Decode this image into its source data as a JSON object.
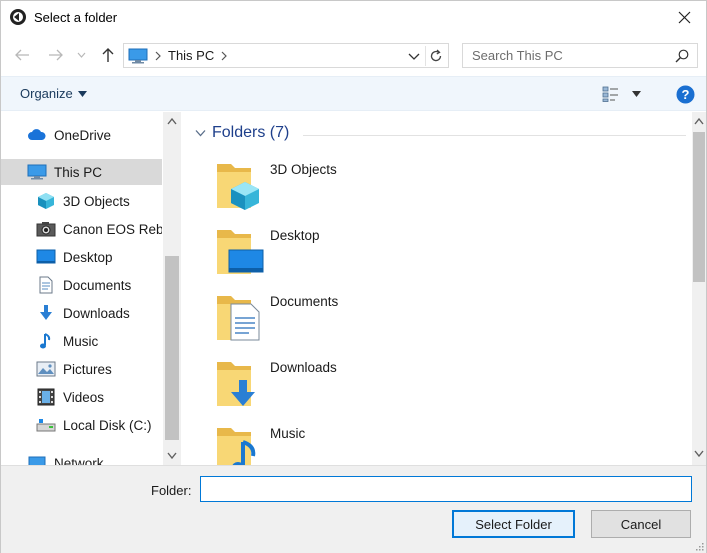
{
  "window": {
    "title": "Select a folder",
    "icon": "app-circle-icon"
  },
  "navigation": {
    "back_icon": "arrow-left-icon",
    "forward_icon": "arrow-right-icon",
    "recent_icon": "chevron-down-icon",
    "up_icon": "arrow-up-icon",
    "breadcrumb": [
      {
        "label": "This PC",
        "icon": "computer-icon"
      }
    ],
    "search_placeholder": "Search This PC"
  },
  "toolbar": {
    "organize_label": "Organize",
    "view_icon": "view-options-icon",
    "help_icon": "help-icon"
  },
  "nav_pane": {
    "items": [
      {
        "label": "OneDrive",
        "icon": "cloud-icon",
        "level": 0,
        "selected": false
      },
      {
        "label": "This PC",
        "icon": "computer-icon",
        "level": 0,
        "selected": true
      },
      {
        "label": "3D Objects",
        "icon": "cube-icon",
        "level": 1,
        "selected": false
      },
      {
        "label": "Canon EOS Rebel",
        "icon": "camera-icon",
        "level": 1,
        "selected": false
      },
      {
        "label": "Desktop",
        "icon": "desktop-icon",
        "level": 1,
        "selected": false
      },
      {
        "label": "Documents",
        "icon": "document-icon",
        "level": 1,
        "selected": false
      },
      {
        "label": "Downloads",
        "icon": "download-icon",
        "level": 1,
        "selected": false
      },
      {
        "label": "Music",
        "icon": "music-note-icon",
        "level": 1,
        "selected": false
      },
      {
        "label": "Pictures",
        "icon": "picture-icon",
        "level": 1,
        "selected": false
      },
      {
        "label": "Videos",
        "icon": "film-icon",
        "level": 1,
        "selected": false
      },
      {
        "label": "Local Disk (C:)",
        "icon": "drive-icon",
        "level": 1,
        "selected": false
      },
      {
        "label": "Network",
        "icon": "network-icon",
        "level": 0,
        "selected": false
      }
    ]
  },
  "content": {
    "group_label": "Folders (7)",
    "folders": [
      {
        "label": "3D Objects",
        "overlay": "cube"
      },
      {
        "label": "Desktop",
        "overlay": "desktop"
      },
      {
        "label": "Documents",
        "overlay": "document"
      },
      {
        "label": "Downloads",
        "overlay": "download"
      },
      {
        "label": "Music",
        "overlay": "music"
      }
    ]
  },
  "footer": {
    "folder_label": "Folder:",
    "folder_value": "",
    "select_button": "Select Folder",
    "cancel_button": "Cancel"
  },
  "colors": {
    "accent": "#0078d7",
    "folder_yellow": "#f8d775",
    "group_header": "#1e3f8b",
    "selection": "#d9d9d9"
  }
}
